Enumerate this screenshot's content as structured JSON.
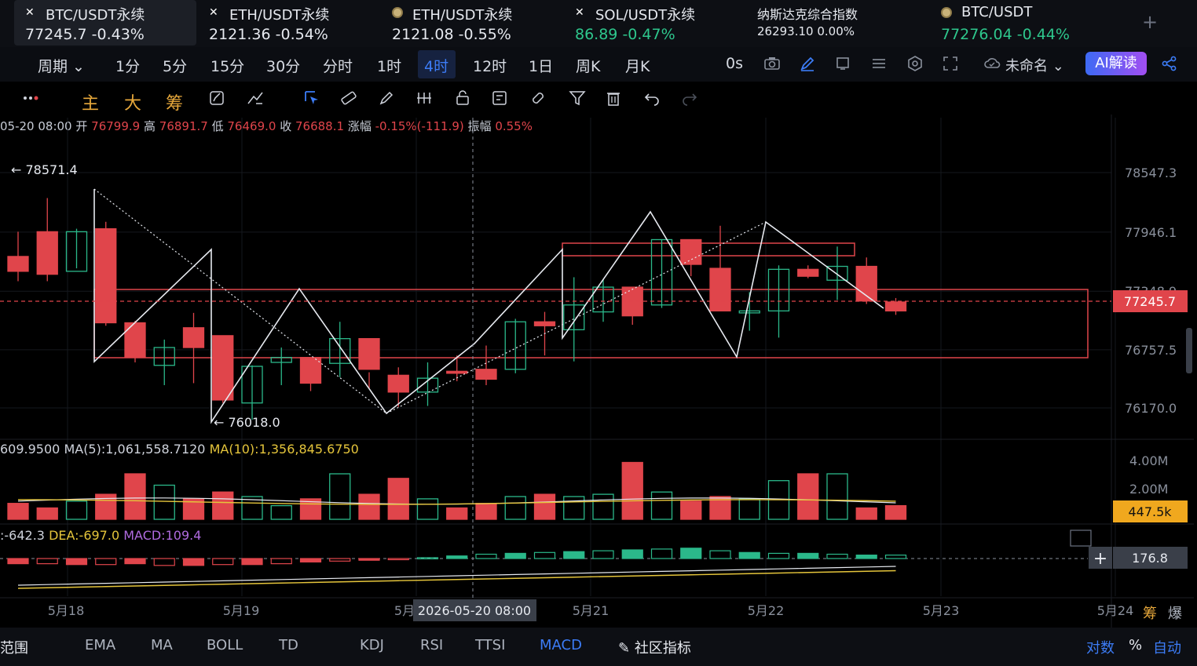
{
  "tickers": [
    {
      "name": "BTC/USDT永续",
      "price": "77245.7",
      "change": "-0.43%",
      "icon": "binance-icon"
    },
    {
      "name": "ETH/USDT永续",
      "price": "2121.36",
      "change": "-0.54%",
      "icon": "binance-icon"
    },
    {
      "name": "ETH/USDT永续",
      "price": "2121.08",
      "change": "-0.55%",
      "icon": "coin-icon"
    },
    {
      "name": "SOL/USDT永续",
      "price": "86.89",
      "change": "-0.47%",
      "icon": "binance-icon"
    },
    {
      "name": "纳斯达克综合指数",
      "price": "26293.10",
      "change": "0.00%",
      "icon": ""
    },
    {
      "name": "BTC/USDT",
      "price": "77276.04",
      "change": "-0.44%",
      "icon": "coin-icon"
    }
  ],
  "intervals": {
    "period": "周期",
    "items": [
      "1分",
      "5分",
      "15分",
      "30分",
      "分时",
      "1时",
      "4时",
      "12时",
      "1日",
      "周K",
      "月K"
    ],
    "active": "4时",
    "countdown": "0s"
  },
  "layout": {
    "name": "未命名",
    "ai_label": "AI解读"
  },
  "draw_tools": {
    "main": "主",
    "big": "大",
    "chip": "筹"
  },
  "ohlc": {
    "time": "05-20 08:00",
    "open_label": "开",
    "open": "76799.9",
    "high_label": "高",
    "high": "76891.7",
    "low_label": "低",
    "low": "76469.0",
    "close_label": "收",
    "close": "76688.1",
    "change_label": "涨幅",
    "change": "-0.15%(-111.9)",
    "amp_label": "振幅",
    "amp": "0.55%"
  },
  "volume_legend": {
    "vol": "609.9500",
    "ma5_label": "MA(5):",
    "ma5": "1,061,558.7120",
    "ma10_label": "MA(10):",
    "ma10": "1,356,845.6750"
  },
  "macd_legend": {
    "dif": ":-642.3",
    "dea_label": "DEA:",
    "dea": "-697.0",
    "macd_label": "MACD:",
    "macd": "109.4"
  },
  "indicators": {
    "range": "范围",
    "items": [
      "EMA",
      "MA",
      "BOLL",
      "TD",
      "KDJ",
      "RSI",
      "TTSI",
      "MACD"
    ],
    "active": "MACD",
    "community": "社区指标",
    "log": "对数",
    "pct": "%",
    "auto": "自动",
    "chip": "筹",
    "burst": "爆"
  },
  "colors": {
    "up": "#2bb88a",
    "down": "#e0454b",
    "accent": "#3c7cf6",
    "vol_ma10": "#e5c53b",
    "price_tag": "#e0454b"
  },
  "chart_data": {
    "type": "candlestick",
    "price_axis": {
      "ticks": [
        78547.3,
        77946.1,
        77348.9,
        76757.5,
        76170.0
      ],
      "ylim": [
        75900,
        78780
      ]
    },
    "current_price": 77245.7,
    "annotations": {
      "high": "78571.4",
      "low": "76018.0"
    },
    "volume_axis": {
      "ticks": [
        "4.00M",
        "2.00M"
      ],
      "current": "447.5k"
    },
    "macd_axis": {
      "current": "176.8"
    },
    "x_labels": [
      "5月18",
      "5月19",
      "5月",
      "5月21",
      "5月22",
      "5月23",
      "5月24"
    ],
    "crosshair_label": "2026-05-20 08:00",
    "candles": [
      [
        77700,
        77950,
        77450,
        77550
      ],
      [
        77950,
        78290,
        77450,
        77520
      ],
      [
        77550,
        77980,
        77580,
        77950
      ],
      [
        77980,
        78050,
        77000,
        77030
      ],
      [
        77030,
        77050,
        76630,
        76680
      ],
      [
        76600,
        76860,
        76400,
        76780
      ],
      [
        76980,
        77130,
        76420,
        76780
      ],
      [
        76900,
        76880,
        76220,
        76250
      ],
      [
        76220,
        76600,
        76050,
        76590
      ],
      [
        76630,
        76780,
        76400,
        76680
      ],
      [
        76680,
        76580,
        76340,
        76420
      ],
      [
        76620,
        77040,
        76480,
        76870
      ],
      [
        76870,
        76530,
        76370,
        76560
      ],
      [
        76500,
        76580,
        76180,
        76330
      ],
      [
        76330,
        76630,
        76190,
        76470
      ],
      [
        76540,
        76700,
        76440,
        76520
      ],
      [
        76560,
        76800,
        76400,
        76460
      ],
      [
        76560,
        77070,
        76520,
        77040
      ],
      [
        77040,
        77140,
        76700,
        77000
      ],
      [
        76960,
        77490,
        76640,
        77210
      ],
      [
        77140,
        77470,
        77040,
        77390
      ],
      [
        77390,
        77210,
        77010,
        77100
      ],
      [
        77210,
        77870,
        77180,
        77870
      ],
      [
        77870,
        77800,
        77500,
        77620
      ],
      [
        77580,
        78010,
        77210,
        77150
      ],
      [
        77130,
        77340,
        76950,
        77150
      ],
      [
        77150,
        77610,
        76880,
        77570
      ],
      [
        77570,
        77610,
        77480,
        77500
      ],
      [
        77460,
        77800,
        77260,
        77600
      ],
      [
        77600,
        77690,
        77220,
        77250
      ],
      [
        77240,
        77280,
        77110,
        77150
      ]
    ],
    "volume": [
      0.35,
      0.25,
      0.4,
      0.55,
      1.0,
      0.75,
      0.45,
      0.6,
      0.5,
      0.3,
      0.45,
      1.0,
      0.55,
      0.9,
      0.45,
      0.25,
      0.35,
      0.5,
      0.55,
      0.5,
      0.55,
      1.25,
      0.6,
      0.4,
      0.5,
      0.45,
      0.85,
      1.0,
      1.0,
      0.25,
      0.3,
      0.45,
      0.35
    ],
    "macd_hist": [
      -0.3,
      -0.3,
      -0.35,
      -0.35,
      -0.3,
      -0.4,
      -0.4,
      -0.35,
      -0.35,
      -0.3,
      -0.2,
      -0.15,
      -0.1,
      -0.05,
      0.05,
      0.15,
      0.25,
      0.3,
      0.35,
      0.4,
      0.45,
      0.5,
      0.55,
      0.6,
      0.45,
      0.35,
      0.3,
      0.3,
      0.25,
      0.2,
      0.2
    ]
  }
}
